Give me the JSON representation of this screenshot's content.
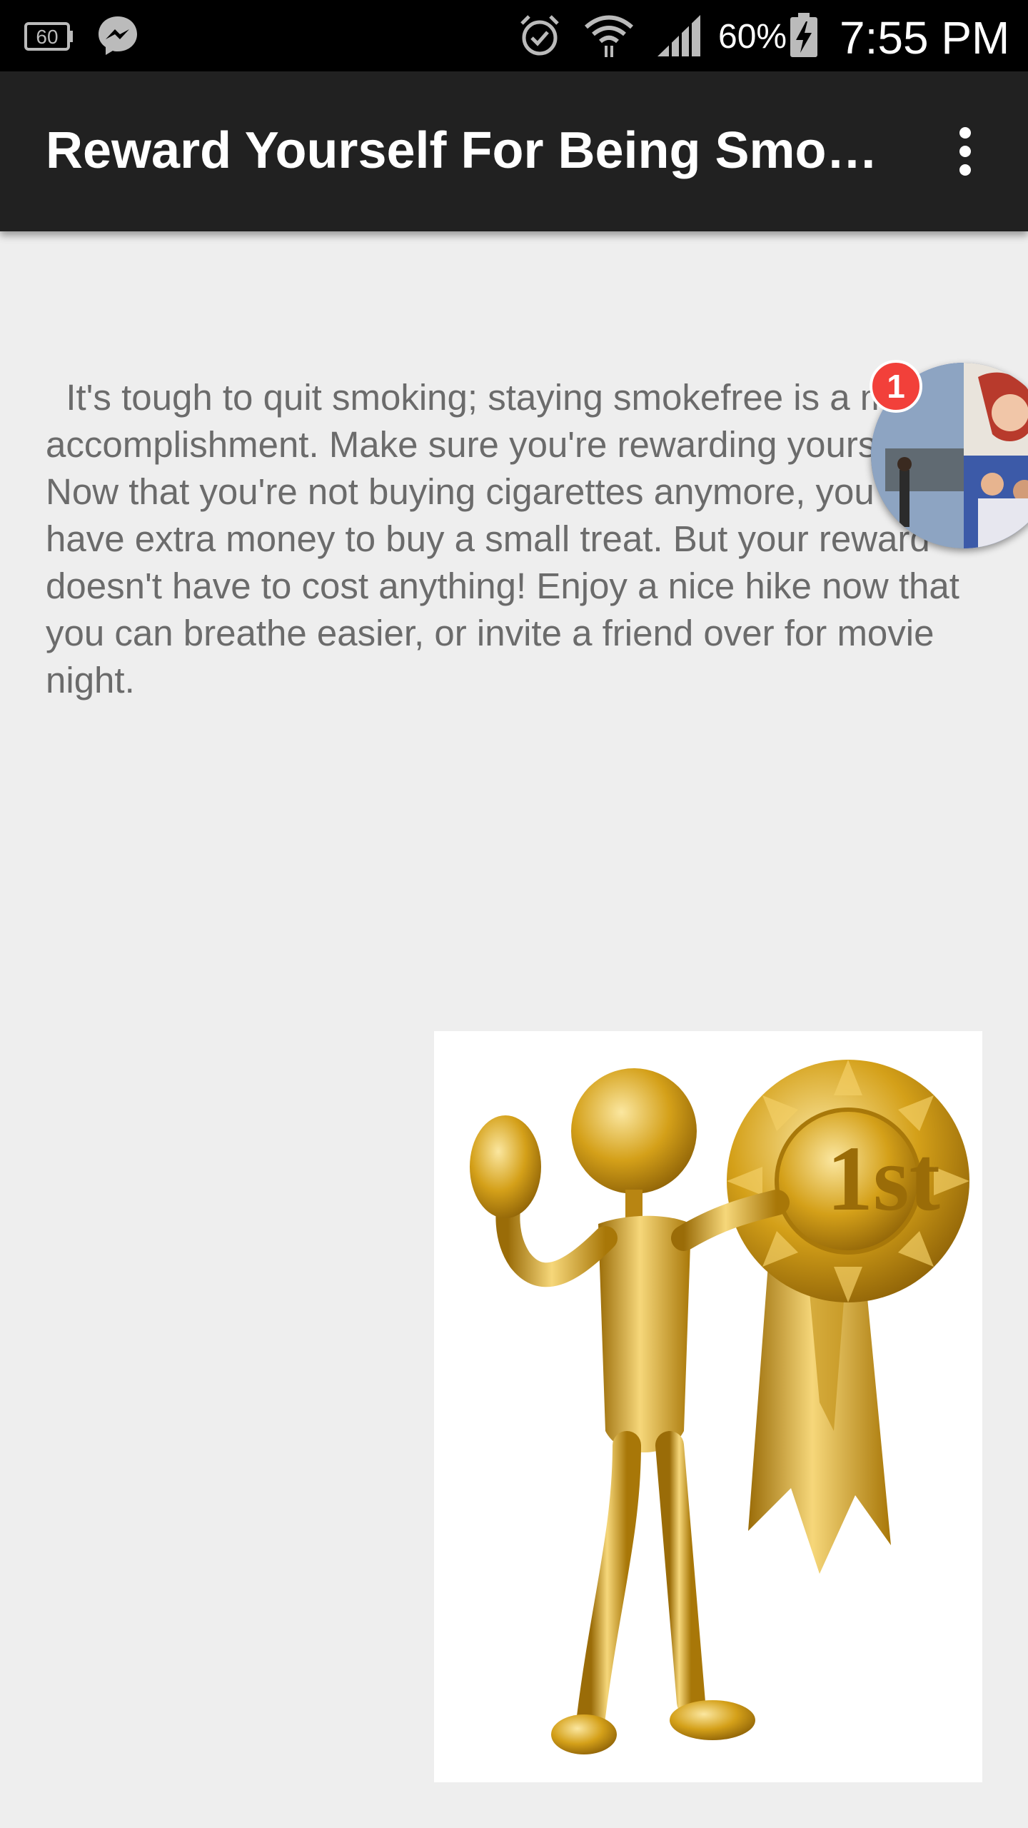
{
  "status_bar": {
    "icons": [
      "speed-60-icon",
      "messenger-icon",
      "alarm-icon",
      "wifi-icon",
      "signal-icon",
      "battery-charging-icon"
    ],
    "battery_percent": "60%",
    "time": "7:55 PM"
  },
  "app_bar": {
    "title": "Reward Yourself For Being Smo…",
    "menu_icon": "more-vert-icon"
  },
  "content": {
    "paragraph": "  It's tough to quit smoking; staying smokefree is a major accomplishment. Make sure you're rewarding yourself. Now that you're not buying cigarettes anymore, you might have extra money to buy a small treat. But your reward doesn't have to cost anything! Enjoy a nice hike now that you can breathe easier, or invite a friend over for movie night."
  },
  "chat_head": {
    "badge_count": "1"
  },
  "image": {
    "icon": "gold-figure-award-icon",
    "ribbon_text": "1st",
    "colors": {
      "gold": "#d4a019",
      "gold_light": "#f6d77a",
      "gold_dark": "#9a6c08"
    }
  }
}
